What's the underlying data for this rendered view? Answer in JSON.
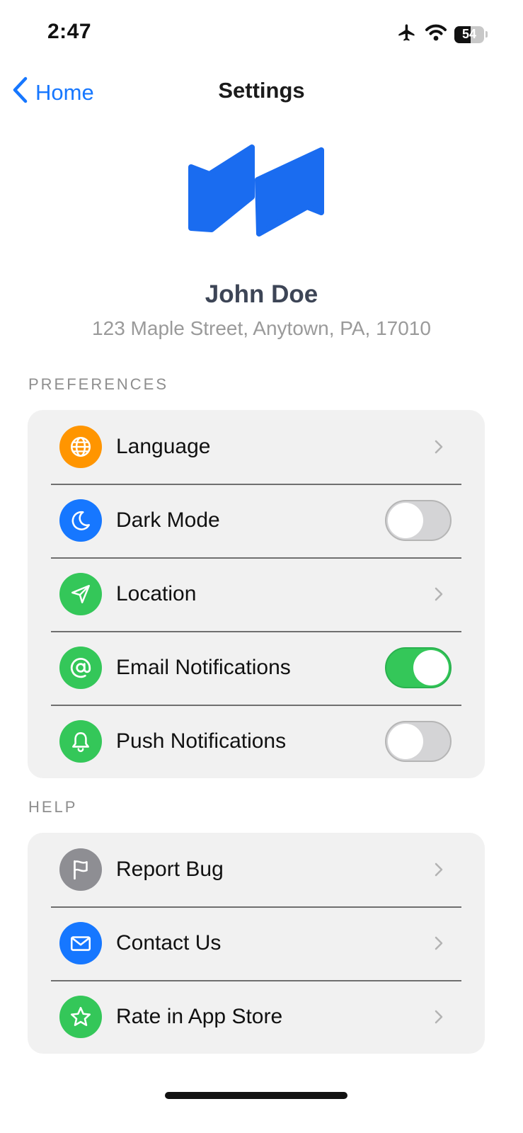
{
  "status_bar": {
    "time": "2:47",
    "battery_level": "54",
    "icons": [
      "airplane-icon",
      "wifi-icon",
      "battery-icon"
    ]
  },
  "nav": {
    "back_label": "Home",
    "title": "Settings"
  },
  "profile": {
    "name": "John Doe",
    "address": "123 Maple Street, Anytown, PA, 17010"
  },
  "preferences": {
    "header": "PREFERENCES",
    "items": [
      {
        "label": "Language",
        "icon": "globe-icon",
        "icon_color": "#ff9500",
        "control": "chevron"
      },
      {
        "label": "Dark Mode",
        "icon": "moon-icon",
        "icon_color": "#1677ff",
        "control": "toggle",
        "on": false
      },
      {
        "label": "Location",
        "icon": "location-arrow-icon",
        "icon_color": "#34c759",
        "control": "chevron"
      },
      {
        "label": "Email Notifications",
        "icon": "at-sign-icon",
        "icon_color": "#34c759",
        "control": "toggle",
        "on": true
      },
      {
        "label": "Push Notifications",
        "icon": "bell-icon",
        "icon_color": "#34c759",
        "control": "toggle",
        "on": false
      }
    ]
  },
  "help": {
    "header": "HELP",
    "items": [
      {
        "label": "Report Bug",
        "icon": "flag-icon",
        "icon_color": "#8e8e93",
        "control": "chevron"
      },
      {
        "label": "Contact Us",
        "icon": "envelope-icon",
        "icon_color": "#1677ff",
        "control": "chevron"
      },
      {
        "label": "Rate in App Store",
        "icon": "star-icon",
        "icon_color": "#34c759",
        "control": "chevron"
      }
    ]
  },
  "colors": {
    "accent": "#1677ff",
    "logo": "#1a6cf0",
    "toggle_on": "#34c759",
    "group_background": "#f1f1f1"
  }
}
